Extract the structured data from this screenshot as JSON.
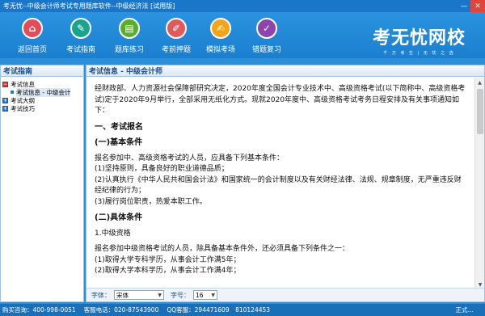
{
  "window": {
    "title": "考无忧--中级会计师考试专用题库软件--中级经济法 [试用版]",
    "min": "—",
    "close": "✕"
  },
  "toolbar": {
    "items": [
      {
        "label": "返回首页",
        "icon": "home-icon",
        "glyph": "⌂",
        "color": "#e34a5a"
      },
      {
        "label": "考试指南",
        "icon": "pen-icon",
        "glyph": "✎",
        "color": "#19a48e"
      },
      {
        "label": "题库练习",
        "icon": "book-icon",
        "glyph": "▤",
        "color": "#5aae2a"
      },
      {
        "label": "考前押题",
        "icon": "pencil-icon",
        "glyph": "✐",
        "color": "#e3585b"
      },
      {
        "label": "模拟考场",
        "icon": "edit-icon",
        "glyph": "✍",
        "color": "#f2a51b"
      },
      {
        "label": "错题复习",
        "icon": "notebook-icon",
        "glyph": "✓",
        "color": "#8e44ad"
      }
    ],
    "brand_name": "考无忧网校",
    "brand_slogan": "千 万 考 生 | 无 忧 之 选"
  },
  "sidebar": {
    "title": "考试指南",
    "tree": [
      {
        "label": "考试信息",
        "expanded": true,
        "children": [
          {
            "label": "考试信息 - 中级会计"
          }
        ]
      },
      {
        "label": "考试大纲",
        "expanded": false
      },
      {
        "label": "考试技巧",
        "expanded": false
      }
    ]
  },
  "content": {
    "title": "考试信息 - 中级会计师",
    "intro": "经财政部、人力资源社会保障部研究决定，2020年度全国会计专业技术中、高级资格考试(以下简称中、高级资格考试)定于2020年9月举行，全部采用无纸化方式。现就2020年度中、高级资格考试考务日程安排及有关事项通知如下：",
    "h1": "一、考试报名",
    "h2": "(一)基本条件",
    "basic_intro": "报名参加中、高级资格考试的人员，应具备下列基本条件：",
    "cond1": "(1)坚持原则，具备良好的职业道德品质；",
    "cond2": "(2)认真执行《中华人民共和国会计法》和国家统一的会计制度以及有关财经法律、法规、规章制度，无严重违反财经纪律的行为；",
    "cond3": "(3)履行岗位职责，热爱本职工作。",
    "h3": "(二)具体条件",
    "sub1": "1.中级资格",
    "mid_intro": "报名参加中级资格考试的人员，除具备基本条件外，还必须具备下列条件之一：",
    "req1": "(1)取得大学专科学历，从事会计工作满5年；",
    "req2": "(2)取得大学本科学历，从事会计工作满4年；"
  },
  "fontbar": {
    "font_label": "字体：",
    "font_value": "宋体",
    "size_label": "字号：",
    "size_value": "16"
  },
  "status": {
    "hotline": "购买咨询：400-998-0051",
    "service": "客服电话：020-87543900",
    "qq": "QQ客服：294471609　810124453",
    "right": "正式…"
  }
}
